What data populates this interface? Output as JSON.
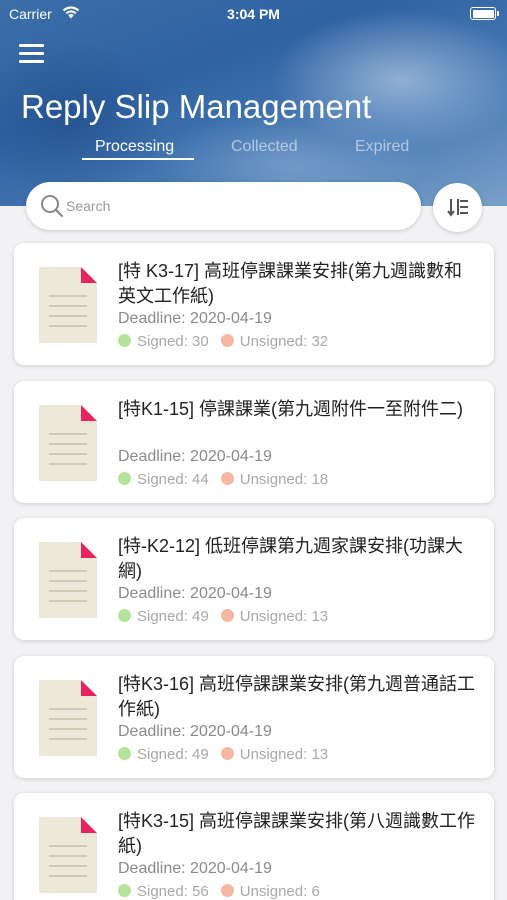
{
  "status_bar": {
    "carrier": "Carrier",
    "time": "3:04 PM"
  },
  "header": {
    "title": "Reply Slip Management"
  },
  "tabs": [
    {
      "label": "Processing",
      "active": true
    },
    {
      "label": "Collected",
      "active": false
    },
    {
      "label": "Expired",
      "active": false
    }
  ],
  "search": {
    "placeholder": "Search",
    "value": ""
  },
  "icons": {
    "menu": "hamburger-menu-icon",
    "search": "search-icon",
    "sort": "sort-icon",
    "document": "document-icon"
  },
  "colors": {
    "header": "#2f62a2",
    "signed_dot": "#b6e39c",
    "unsigned_dot": "#f5b7a3",
    "document_corner": "#e8245c"
  },
  "slips": [
    {
      "title": "[特 K3-17] 高班停課課業安排(第九週識數和英文工作紙)",
      "deadline": "Deadline: 2020-04-19",
      "signed": "Signed: 30",
      "unsigned": "Unsigned: 32"
    },
    {
      "title": "[特K1-15] 停課課業(第九週附件一至附件二)",
      "deadline": "Deadline: 2020-04-19",
      "signed": "Signed: 44",
      "unsigned": "Unsigned: 18"
    },
    {
      "title": "[特-K2-12] 低班停課第九週家課安排(功課大網)",
      "deadline": "Deadline: 2020-04-19",
      "signed": "Signed: 49",
      "unsigned": "Unsigned: 13"
    },
    {
      "title": "[特K3-16] 高班停課課業安排(第九週普通話工作紙)",
      "deadline": "Deadline: 2020-04-19",
      "signed": "Signed: 49",
      "unsigned": "Unsigned: 13"
    },
    {
      "title": "[特K3-15] 高班停課課業安排(第八週識數工作紙)",
      "deadline": "Deadline: 2020-04-19",
      "signed": "Signed: 56",
      "unsigned": "Unsigned: 6"
    }
  ]
}
